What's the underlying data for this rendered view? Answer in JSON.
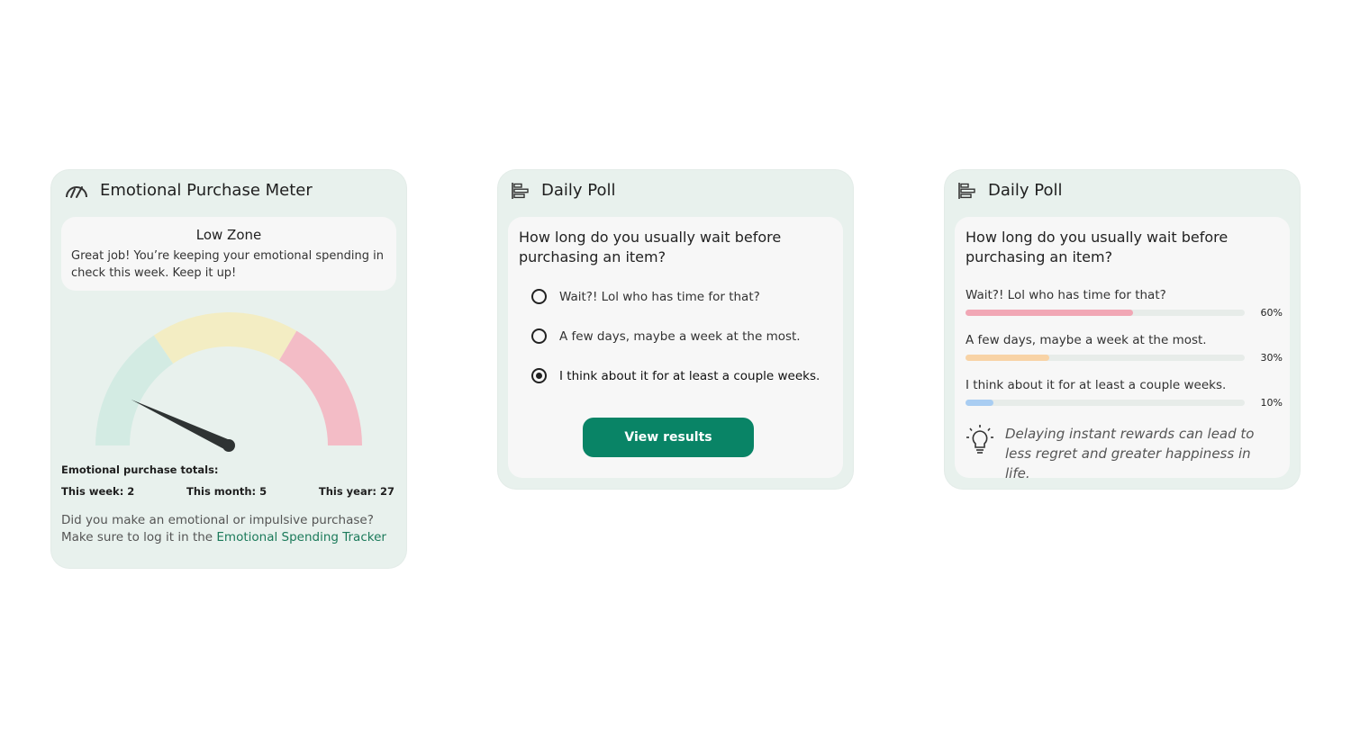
{
  "meter": {
    "title": "Emotional Purchase Meter",
    "zone_title": "Low Zone",
    "zone_description": "Great job! You’re keeping your emotional spending in check this week. Keep it up!",
    "gauge_value": 0.14,
    "zone_colors": [
      "#d3ebe3",
      "#f3edc3",
      "#f3bcc6"
    ],
    "totals_label": "Emotional purchase totals:",
    "totals": [
      {
        "label": "This week: 2"
      },
      {
        "label": "This month: 5"
      },
      {
        "label": "This year: 27"
      }
    ],
    "prompt_line1": "Did you make an emotional or impulsive purchase?",
    "prompt_line2": "Make sure to log it in the ",
    "tracker_link": "Emotional Spending Tracker"
  },
  "poll": {
    "title": "Daily Poll",
    "question": "How long do you usually wait before purchasing an item?",
    "options": [
      {
        "label": "Wait?! Lol who has time for that?",
        "selected": false
      },
      {
        "label": "A few days, maybe a week at the most.",
        "selected": false
      },
      {
        "label": "I think about it for at least a couple weeks.",
        "selected": true
      }
    ],
    "button_label": "View results"
  },
  "results": {
    "title": "Daily Poll",
    "question": "How long do you usually wait before purchasing an item?",
    "items": [
      {
        "label": "Wait?! Lol who has time for that?",
        "percent": 60,
        "percent_label": "60%",
        "color": "#f1a7b5"
      },
      {
        "label": "A few days, maybe a week at the most.",
        "percent": 30,
        "percent_label": "30%",
        "color": "#f8d3a6"
      },
      {
        "label": "I think about it for at least a couple weeks.",
        "percent": 10,
        "percent_label": "10%",
        "color": "#a9cdf2"
      }
    ],
    "tip": "Delaying instant rewards can lead to less regret and greater happiness in life.",
    "icons": {
      "header": "poll-chart-icon",
      "tip": "lightbulb-icon"
    }
  },
  "colors": {
    "brand_green": "#098466",
    "card_bg": "#e8f1ed"
  }
}
